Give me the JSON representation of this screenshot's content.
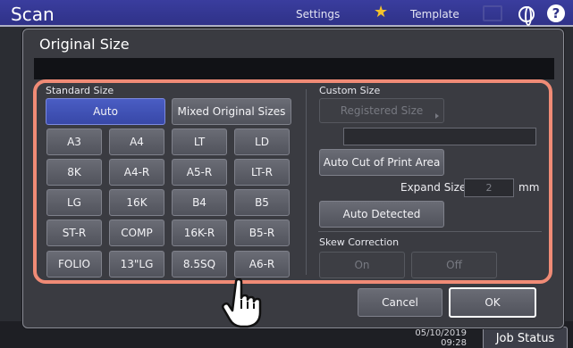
{
  "topbar": {
    "app_title": "Scan",
    "settings_label": "Settings",
    "template_label": "Template",
    "star_icon": "star-icon",
    "home_icon": "home-icon",
    "globe_icon": "globe-icon",
    "help_icon": "help-icon",
    "help_glyph": "?"
  },
  "statusbar": {
    "date": "05/10/2019",
    "time": "09:28",
    "job_status_label": "Job Status"
  },
  "dialog": {
    "title": "Original Size",
    "standard_size": {
      "label": "Standard Size",
      "auto_label": "Auto",
      "auto_selected": true,
      "mixed_label": "Mixed Original Sizes",
      "sizes": [
        [
          "A3",
          "A4",
          "LT",
          "LD"
        ],
        [
          "8K",
          "A4-R",
          "A5-R",
          "LT-R"
        ],
        [
          "LG",
          "16K",
          "B4",
          "B5"
        ],
        [
          "ST-R",
          "COMP",
          "16K-R",
          "B5-R"
        ],
        [
          "FOLIO",
          "13\"LG",
          "8.5SQ",
          "A6-R"
        ]
      ]
    },
    "custom_size": {
      "label": "Custom Size",
      "registered_size_label": "Registered Size",
      "registered_size_value": "",
      "auto_cut_label": "Auto Cut of Print Area",
      "expand_size_label": "Expand Size",
      "expand_size_value": "2",
      "expand_size_unit": "mm",
      "auto_detected_label": "Auto Detected"
    },
    "skew_correction": {
      "label": "Skew Correction",
      "on_label": "On",
      "off_label": "Off"
    },
    "cancel_label": "Cancel",
    "ok_label": "OK"
  },
  "colors": {
    "accent_blue": "#3f52b8",
    "highlight": "#f08b76",
    "dialog_bg": "#3a3b41",
    "topbar": "#2f3288"
  }
}
